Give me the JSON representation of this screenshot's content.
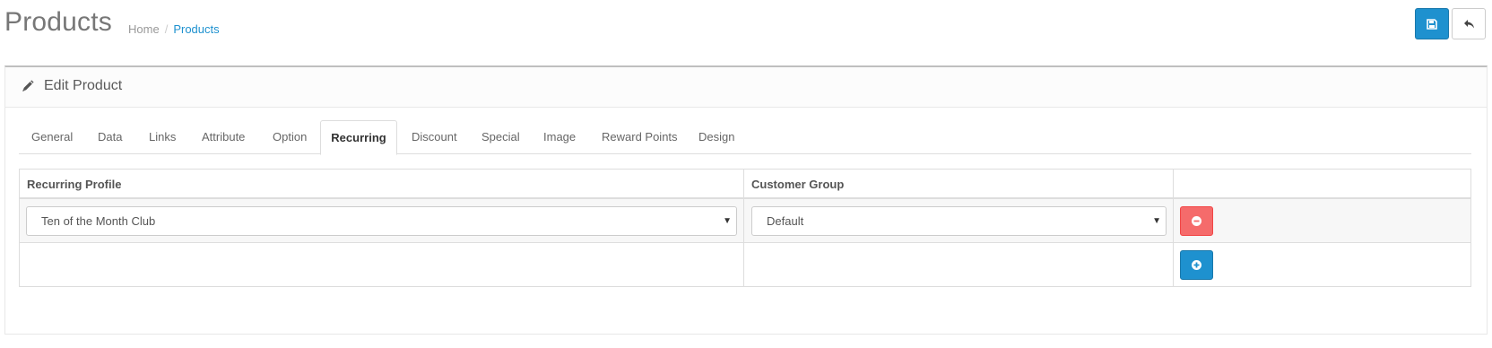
{
  "header": {
    "title": "Products",
    "breadcrumb": [
      {
        "label": "Home"
      },
      {
        "label": "Products"
      }
    ],
    "breadcrumb_separator": "/",
    "save_icon": "floppy-disk-icon",
    "back_icon": "reply-arrow-icon"
  },
  "panel": {
    "title": "Edit Product",
    "icon": "pencil-icon"
  },
  "tabs": [
    {
      "label": "General"
    },
    {
      "label": "Data"
    },
    {
      "label": "Links"
    },
    {
      "label": "Attribute"
    },
    {
      "label": "Option"
    },
    {
      "label": "Recurring",
      "active": true
    },
    {
      "label": "Discount"
    },
    {
      "label": "Special"
    },
    {
      "label": "Image"
    },
    {
      "label": "Reward Points"
    },
    {
      "label": "Design"
    }
  ],
  "recurring_table": {
    "columns": [
      "Recurring Profile",
      "Customer Group",
      ""
    ],
    "rows": [
      {
        "recurring_profile": "Ten of the Month Club",
        "customer_group": "Default",
        "action_icon": "minus-circle-icon"
      }
    ],
    "add_icon": "plus-circle-icon"
  },
  "colors": {
    "primary": "#1e91cf",
    "danger": "#f56b6b",
    "breadcrumb_link": "#1e91cf"
  }
}
